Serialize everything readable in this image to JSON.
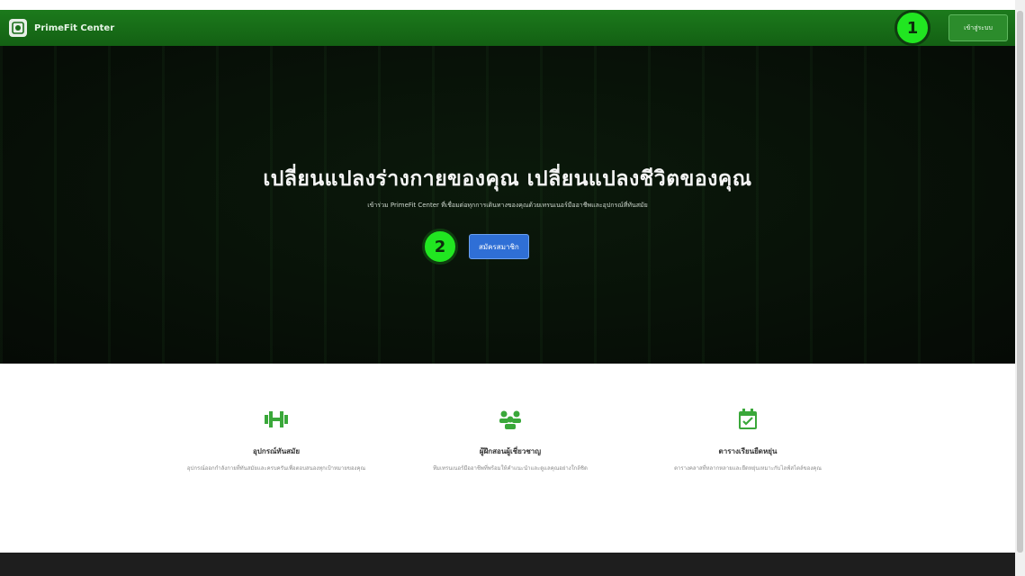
{
  "navbar": {
    "brand": "PrimeFit Center",
    "marker_label": "1",
    "button_label": "เข้าสู่ระบบ"
  },
  "hero": {
    "title": "เปลี่ยนแปลงร่างกายของคุณ เปลี่ยนแปลงชีวิตของคุณ",
    "subtitle": "เข้าร่วม PrimeFit Center ที่เชื่อมต่อทุกการเดินทางของคุณด้วยเทรนเนอร์มืออาชีพและอุปกรณ์ที่ทันสมัย",
    "marker_label": "2",
    "cta_label": "สมัครสมาชิก"
  },
  "features": [
    {
      "icon": "dumbbell-icon",
      "title": "อุปกรณ์ทันสมัย",
      "desc": "อุปกรณ์ออกกำลังกายที่ทันสมัยและครบครันเพื่อตอบสนองทุกเป้าหมายของคุณ"
    },
    {
      "icon": "trainer-group-icon",
      "title": "ผู้ฝึกสอนผู้เชี่ยวชาญ",
      "desc": "ทีมเทรนเนอร์มืออาชีพที่พร้อมให้คำแนะนำและดูแลคุณอย่างใกล้ชิด"
    },
    {
      "icon": "calendar-icon",
      "title": "ตารางเรียนยืดหยุ่น",
      "desc": "ตารางคลาสที่หลากหลายและยืดหยุ่นเหมาะกับไลฟ์สไตล์ของคุณ"
    }
  ],
  "colors": {
    "nav": "#136013",
    "accent": "#2f6fd6",
    "feature_icon": "#3aa83a",
    "marker": "#21e621"
  }
}
